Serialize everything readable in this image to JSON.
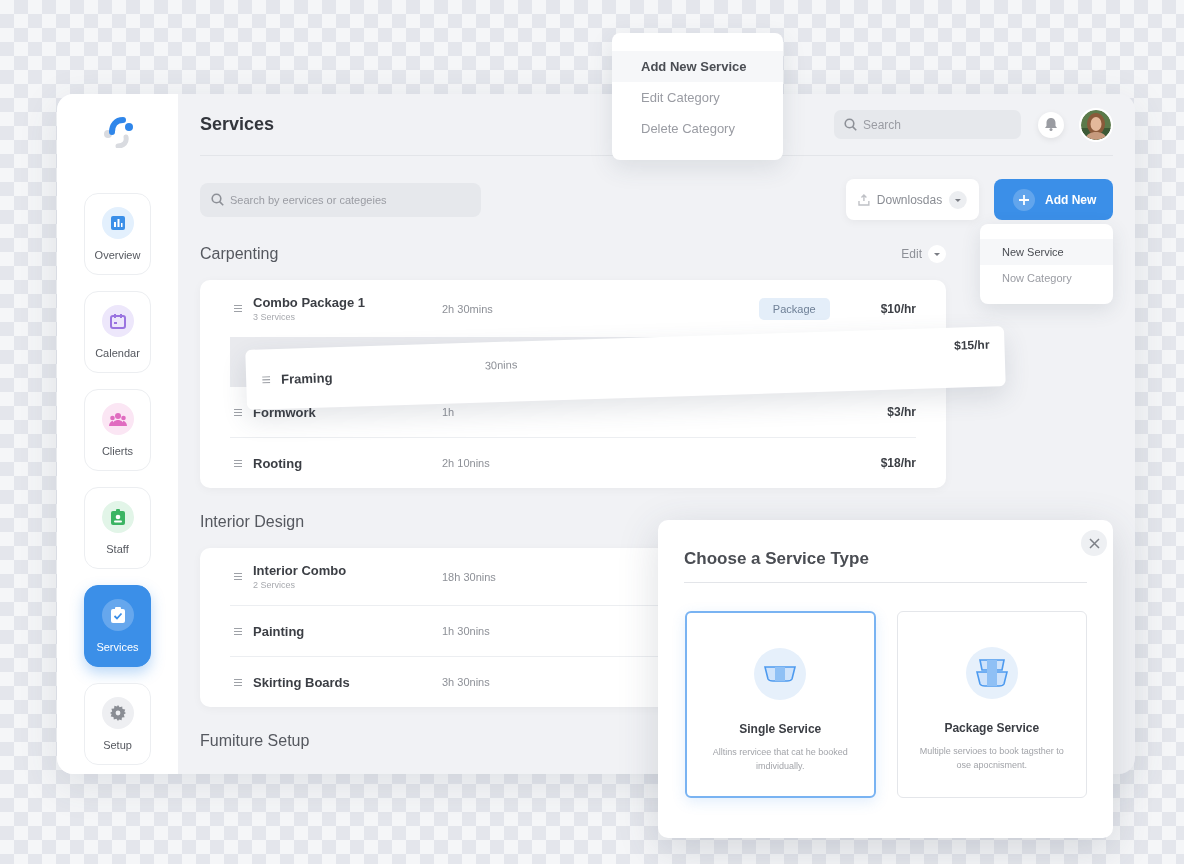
{
  "sidebar": {
    "items": [
      {
        "label": "Overview",
        "kind": "overview",
        "selected": false
      },
      {
        "label": "Calendar",
        "kind": "calendar",
        "selected": false
      },
      {
        "label": "Clierts",
        "kind": "clients",
        "selected": false
      },
      {
        "label": "Staff",
        "kind": "staff",
        "selected": false
      },
      {
        "label": "Services",
        "kind": "services",
        "selected": true
      },
      {
        "label": "Setup",
        "kind": "setup",
        "selected": false
      }
    ]
  },
  "header": {
    "title": "Services",
    "search": {
      "placeholder": "Search"
    }
  },
  "toolbar": {
    "search": {
      "placeholder": "Search by eervices or categeies"
    },
    "download_button": "Downlosdas",
    "add_button": "Add New"
  },
  "context_menu": {
    "items": [
      {
        "label": "Add New Service",
        "selected": true
      },
      {
        "label": "Edit Category",
        "selected": false
      },
      {
        "label": "Delete Category",
        "selected": false
      }
    ]
  },
  "add_menu": {
    "items": [
      {
        "label": "New Service",
        "selected": true
      },
      {
        "label": "Now Category",
        "selected": false
      }
    ]
  },
  "categories": [
    {
      "title": "Carpenting",
      "edit": "Edit",
      "rows": [
        {
          "kind": "row",
          "name": "Combo Package 1",
          "subtitle": "3 Services",
          "duration": "2h 30mins",
          "tag": "Package",
          "price": "$10/hr"
        },
        {
          "kind": "drop_slot"
        },
        {
          "kind": "row",
          "name": "Formwork",
          "duration": "1h",
          "price": "$3/hr"
        },
        {
          "kind": "row",
          "name": "Rooting",
          "duration": "2h 10nins",
          "price": "$18/hr"
        }
      ]
    },
    {
      "title": "Interior Design",
      "rows": [
        {
          "kind": "row",
          "name": "Interior Combo",
          "subtitle": "2 Services",
          "duration": "18h 30nins"
        },
        {
          "kind": "row",
          "name": "Painting",
          "duration": "1h 30nins"
        },
        {
          "kind": "row",
          "name": "Skirting Boards",
          "duration": "3h 30nins"
        }
      ]
    },
    {
      "title": "Fumiture Setup"
    }
  ],
  "dragged_row": {
    "name": "Framing",
    "duration": "30nins",
    "price": "$15/hr"
  },
  "modal": {
    "title": "Choose a Service Type",
    "options": [
      {
        "kind": "single",
        "title": "Single Service",
        "description": "Alltins rervicee that cat he booked imdividually.",
        "selected": true
      },
      {
        "kind": "package",
        "title": "Package Service",
        "description": "Multiple servioes to book tagsther to ose apocnisment.",
        "selected": false
      }
    ]
  }
}
